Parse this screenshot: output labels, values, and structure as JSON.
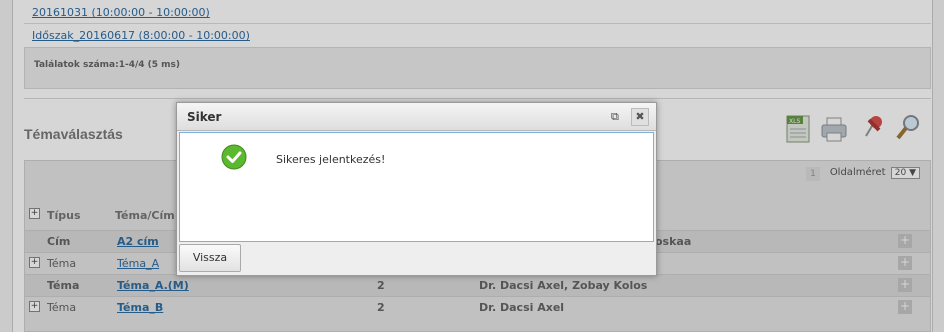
{
  "periods": [
    "20161031 (10:00:00 - 10:00:00)",
    "Időszak_20160617 (8:00:00 - 10:00:00)"
  ],
  "results": {
    "text": "Találatok száma:1-4/4 (5 ms)"
  },
  "section": {
    "title": "Témaválasztás"
  },
  "toolbar": {
    "icons": [
      "xls-export-icon",
      "print-icon",
      "pin-icon",
      "search-icon"
    ]
  },
  "pagination": {
    "page": "1",
    "pagesize_label": "Oldalméret",
    "pagesize_value": "20 ▼"
  },
  "grid": {
    "headers": {
      "type": "Típus",
      "title": "Téma/Cím"
    },
    "rows": [
      {
        "type": "Cím",
        "title": "A2 cím",
        "count": "",
        "people": "oskaa",
        "expandable": false
      },
      {
        "type": "Téma",
        "title": "Téma_A",
        "count": "",
        "people": "",
        "expandable": true
      },
      {
        "type": "Téma",
        "title": "Téma_A.(M)",
        "count": "2",
        "people": "Dr. Dacsi Axel, Zobay Kolos",
        "expandable": false
      },
      {
        "type": "Téma",
        "title": "Téma_B",
        "count": "2",
        "people": "Dr. Dacsi Axel",
        "expandable": true
      }
    ]
  },
  "dialog": {
    "title": "Siker",
    "message": "Sikeres jelentkezés!",
    "back_label": "Vissza"
  },
  "colors": {
    "link": "#2f6ea4",
    "success": "#5cb82e"
  }
}
